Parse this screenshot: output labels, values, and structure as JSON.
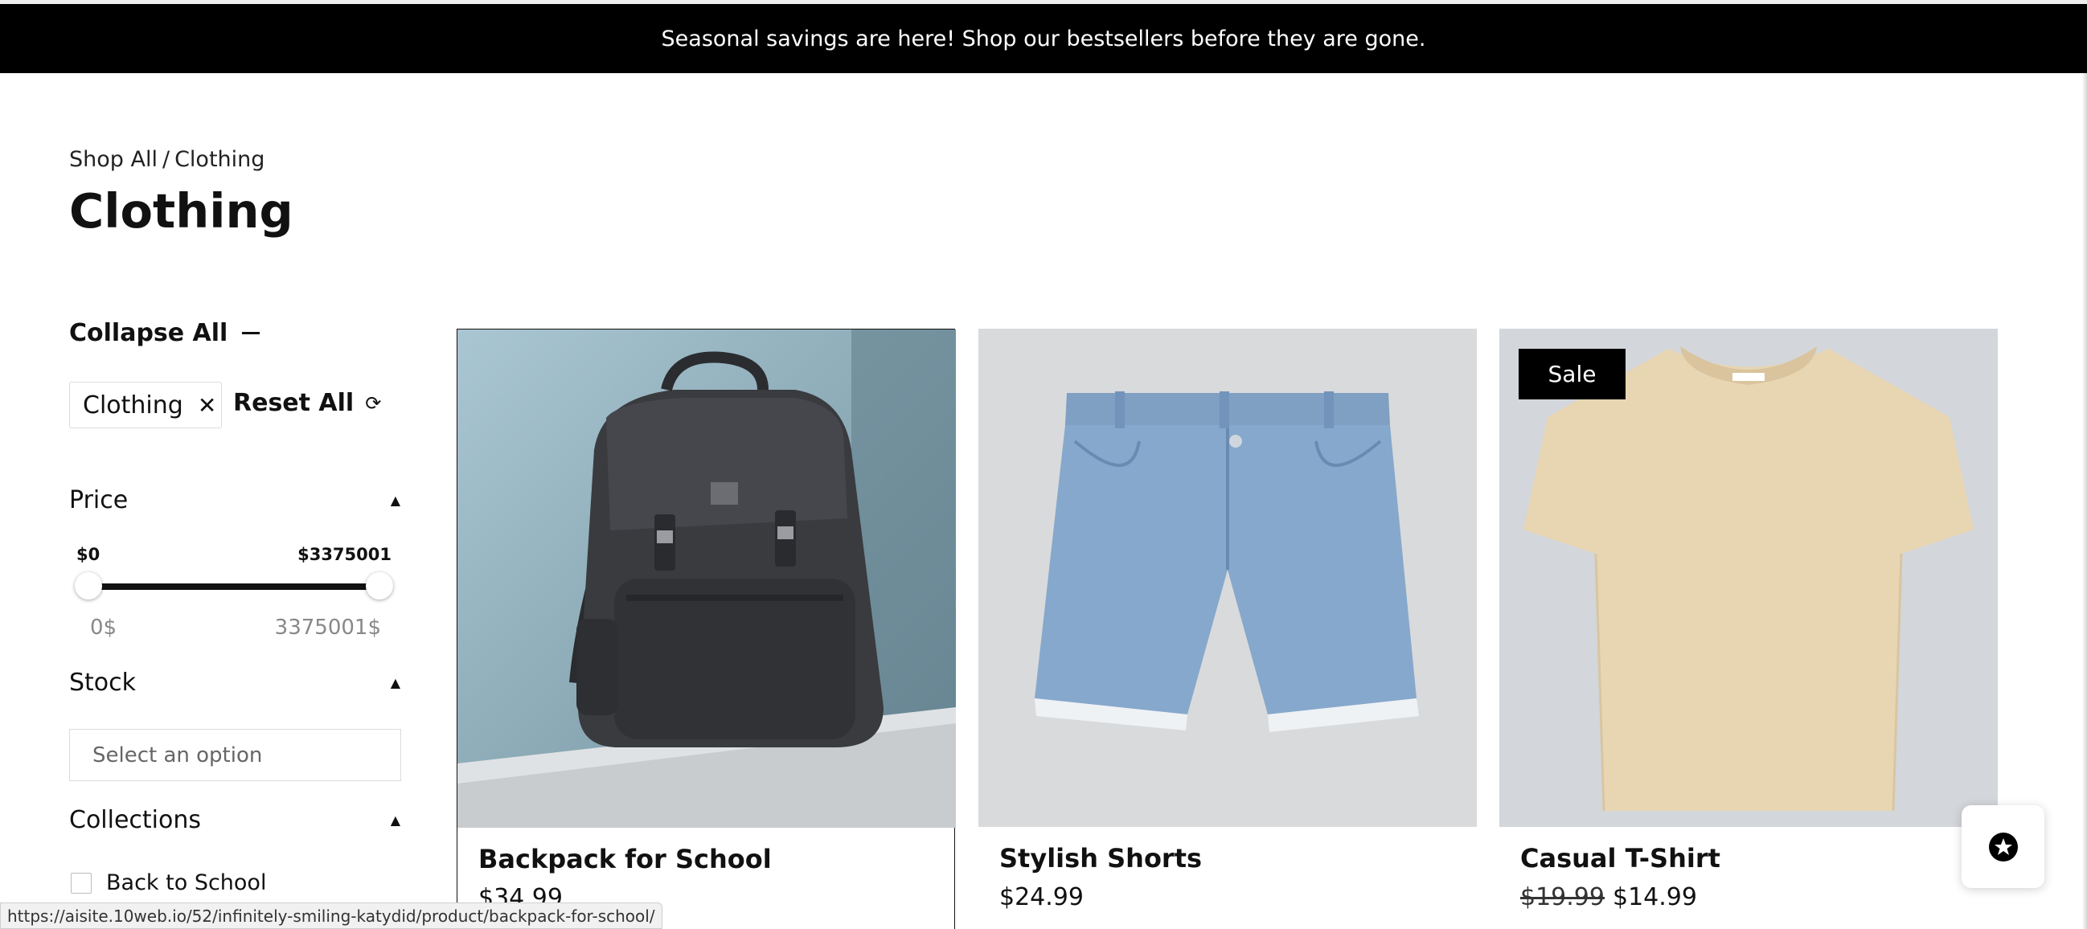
{
  "announcement": "Seasonal savings are here! Shop our bestsellers before they are gone.",
  "breadcrumb": {
    "root": "Shop All",
    "separator": "/",
    "current": "Clothing"
  },
  "page_title": "Clothing",
  "filters": {
    "collapse_all": "Collapse All",
    "active_chip": "Clothing",
    "chip_remove_icon": "close-icon",
    "reset_all": "Reset All",
    "price": {
      "label": "Price",
      "min_label": "$0",
      "max_label": "$3375001",
      "min_input": "0$",
      "max_input": "3375001$",
      "range_min": 0,
      "range_max": 3375001
    },
    "stock": {
      "label": "Stock",
      "placeholder": "Select an option"
    },
    "collections": {
      "label": "Collections",
      "items": [
        "Back to School"
      ]
    }
  },
  "products": [
    {
      "name": "Backpack for School",
      "price": "$34.99",
      "old_price": "",
      "badge": ""
    },
    {
      "name": "Stylish Shorts",
      "price": "$24.99",
      "old_price": "",
      "badge": ""
    },
    {
      "name": "Casual T-Shirt",
      "price": "$14.99",
      "old_price": "$19.99",
      "badge": "Sale"
    }
  ],
  "status_url": "https://aisite.10web.io/52/infinitely-smiling-katydid/product/backpack-for-school/",
  "colors": {
    "accent": "#000000",
    "background": "#ffffff",
    "tshirt": "#e8d6b3",
    "denim": "#86a8cc",
    "backpack": "#3a3b3f"
  }
}
